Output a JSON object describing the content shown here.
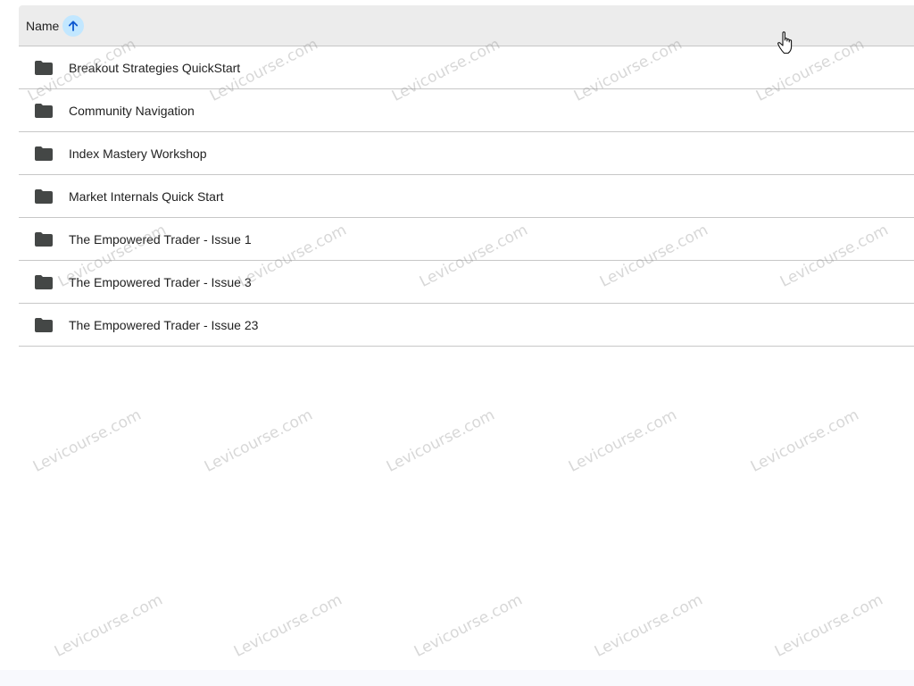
{
  "header": {
    "column_label": "Name",
    "sort_direction": "ascending",
    "sort_icon": "arrow-up-icon",
    "sort_accent": "#c2e7ff"
  },
  "rows": [
    {
      "label": "Breakout Strategies QuickStart",
      "icon": "folder-icon"
    },
    {
      "label": "Community Navigation",
      "icon": "folder-icon"
    },
    {
      "label": "Index Mastery Workshop",
      "icon": "folder-icon"
    },
    {
      "label": "Market Internals Quick Start",
      "icon": "folder-icon"
    },
    {
      "label": "The Empowered Trader - Issue 1",
      "icon": "folder-icon"
    },
    {
      "label": "The Empowered Trader - Issue 3",
      "icon": "folder-icon"
    },
    {
      "label": "The Empowered Trader - Issue 23",
      "icon": "folder-icon"
    }
  ],
  "watermark": {
    "text": "Levicourse.com"
  },
  "cursor": {
    "icon": "hand-pointer-icon"
  }
}
